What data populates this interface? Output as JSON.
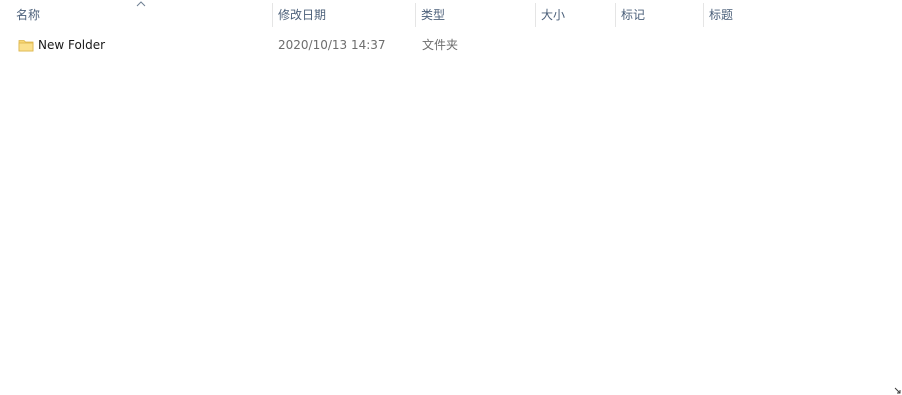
{
  "columns": {
    "name": "名称",
    "modified": "修改日期",
    "type": "类型",
    "size": "大小",
    "tags": "标记",
    "title": "标题"
  },
  "sort": {
    "column": "name",
    "direction": "ascending",
    "icon": "chevron-up-icon"
  },
  "files": [
    {
      "name": "New Folder",
      "modified": "2020/10/13 14:37",
      "type": "文件夹",
      "icon": "folder-icon"
    }
  ],
  "colors": {
    "header_text": "#4c607a",
    "detail_text": "#6d6d6d",
    "folder_yellow": "#f8d775"
  }
}
